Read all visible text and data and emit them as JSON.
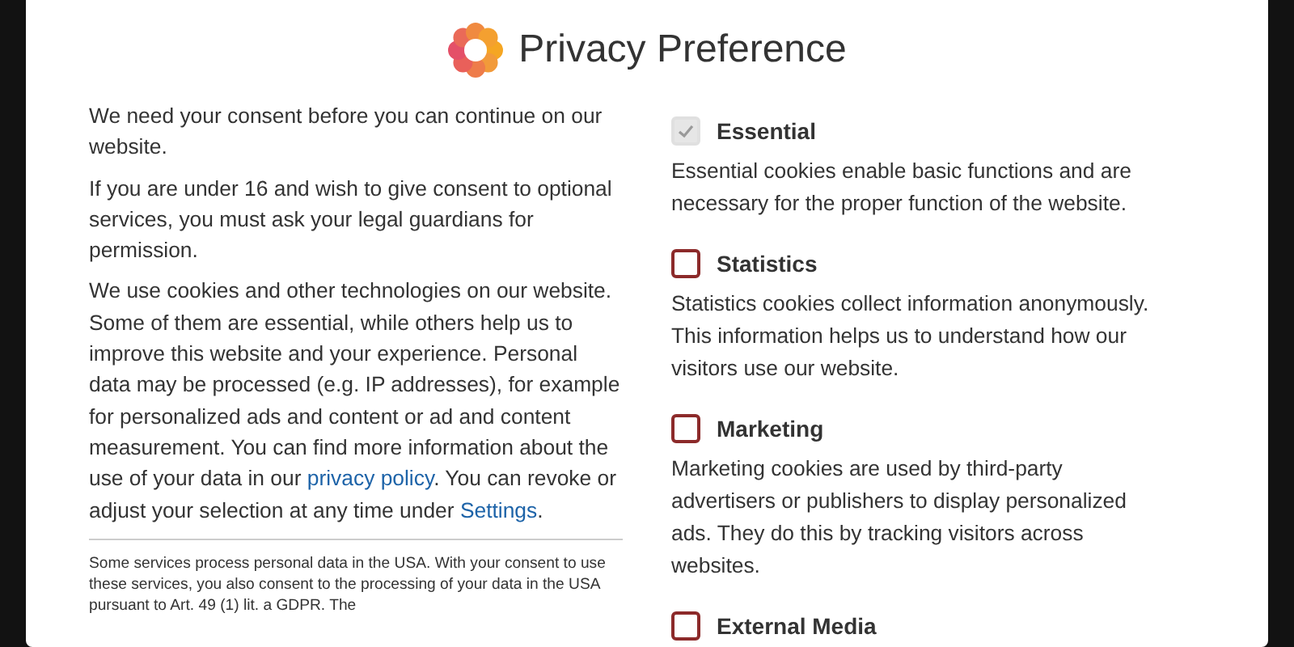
{
  "dialog": {
    "title": "Privacy Preference",
    "paragraphs": [
      [
        {
          "text": "We need your consent before you can continue on our website."
        }
      ],
      [
        {
          "text": "If you are under 16 and wish to give consent to optional services, you must ask your legal guardians for permission."
        }
      ],
      [
        {
          "text": "We use cookies and other technologies on our website. Some of them are essential, while others help us to improve this website and your experience. Personal data may be processed (e.g. IP addresses), for example for personalized ads and content or ad and content measurement. You can find more information about the use of your data in our "
        },
        {
          "text": "privacy policy",
          "kind": "link"
        },
        {
          "text": ". You can revoke or adjust your selection at any time under "
        },
        {
          "text": "Settings",
          "kind": "link"
        },
        {
          "text": "."
        }
      ]
    ],
    "footnote": "Some services process personal data in the USA. With your consent to use these services, you also consent to the processing of your data in the USA pursuant to Art. 49 (1) lit. a GDPR. The",
    "categories": [
      {
        "label": "Essential",
        "checked": true,
        "disabled": true,
        "description": "Essential cookies enable basic functions and are necessary for the proper function of the website."
      },
      {
        "label": "Statistics",
        "checked": false,
        "disabled": false,
        "description": "Statistics cookies collect information anonymously. This information helps us to understand how our visitors use our website."
      },
      {
        "label": "Marketing",
        "checked": false,
        "disabled": false,
        "description": "Marketing cookies are used by third-party advertisers or publishers to display personalized ads. They do this by tracking visitors across websites."
      },
      {
        "label": "External Media",
        "checked": false,
        "disabled": false
      }
    ]
  }
}
